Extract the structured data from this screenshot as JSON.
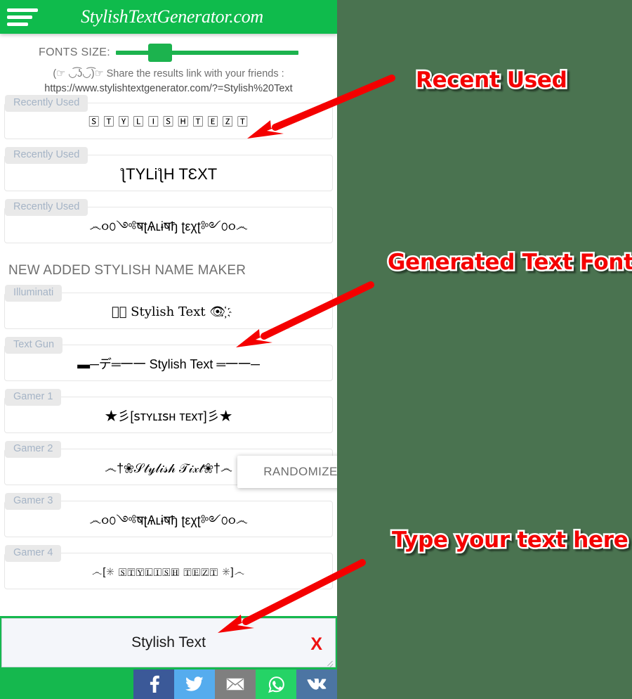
{
  "header": {
    "menu_icon": "hamburger-icon",
    "title": "StylishTextGenerator.com",
    "brand_green": "#0fbb4c"
  },
  "controls": {
    "fontsize_label": "FONTS SIZE:",
    "slider_value_pct": 18,
    "share_prompt": "(☞ ◡͡ʖ◡͡)☞ Share the results link with your friends :",
    "share_url": "https://www.stylishtextgenerator.com/?=Stylish%20Text"
  },
  "recent_section": {
    "rows": [
      {
        "chip": "Recently Used",
        "sample": "🅂 🅃 🅈 🄻 🄸 🅂 🄷  🅃 🄴 🅉 🅃",
        "style": "boxed"
      },
      {
        "chip": "Recently Used",
        "sample": "ƪTYLiƪH TƐXT",
        "style": "big"
      },
      {
        "chip": "Recently Used",
        "sample": "෴૦௦༺षʈѦʟɨषђ ʈεχʈ༻௦૦෴",
        "style": "plain"
      }
    ]
  },
  "maker_section": {
    "title": "NEW ADDED STYLISH NAME MAKER",
    "rows": [
      {
        "chip": "Illuminati",
        "sample": "👁҉ Stylish Text 👁҉",
        "style": "serifstyle"
      },
      {
        "chip": "Text Gun",
        "sample": "▬─デ═一一 Stylish Text ═一一─",
        "style": "plain"
      },
      {
        "chip": "Gamer 1",
        "sample": "★彡[ꜱᴛʏʟɪꜱʜ ᴛᴇхᴛ]彡★",
        "style": "plain"
      },
      {
        "chip": "Gamer 2",
        "sample": "෴†❀𝒮𝓉𝓎𝓁𝒾𝓈𝒽 𝒯𝒾𝓍𝓉❀†෴",
        "style": "plain"
      },
      {
        "chip": "Gamer 3",
        "sample": "෴૦௦༺षʈѦʟɨषђ ʈεχʈ༻௦૦෴",
        "style": "plain"
      },
      {
        "chip": "Gamer 4",
        "sample": "෴[✳ 🅂🅃🅈🄻🄸🅂🄷 🅃🄴🅉🅃 ✳]෴",
        "style": "boxed"
      }
    ]
  },
  "randomize": {
    "label": "RANDOMIZE"
  },
  "input_bar": {
    "value": "Stylish Text",
    "placeholder": "Type your text here",
    "clear_label": "X",
    "clear_color": "#ee1111"
  },
  "social_bar": {
    "buttons": [
      {
        "name": "facebook",
        "color": "#3b5998"
      },
      {
        "name": "twitter",
        "color": "#55acee"
      },
      {
        "name": "email",
        "color": "#7f7f7f"
      },
      {
        "name": "whatsapp",
        "color": "#25d366"
      },
      {
        "name": "vk",
        "color": "#4c75a3"
      }
    ]
  },
  "annotations": {
    "recent": "Recent Used",
    "generated": "Generated Text Fonts",
    "type_here": "Type your text here",
    "arrow_color": "#f40000",
    "label_color": "#f40000"
  },
  "page": {
    "background": "#4a7350"
  }
}
